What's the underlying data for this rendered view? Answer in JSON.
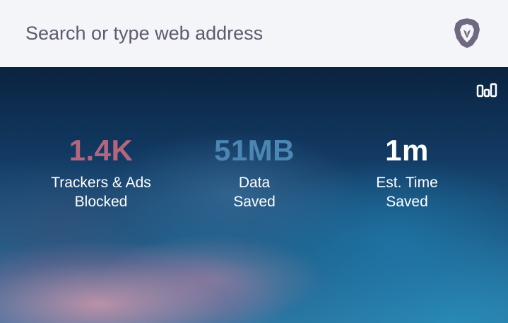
{
  "search": {
    "placeholder": "Search or type web address"
  },
  "icons": {
    "browser_logo": "brave-lion-icon",
    "stats": "stats-chart-icon"
  },
  "stats": [
    {
      "value": "1.4K",
      "label_line1": "Trackers & Ads",
      "label_line2": "Blocked",
      "color": "#b4667f"
    },
    {
      "value": "51MB",
      "label_line1": "Data",
      "label_line2": "Saved",
      "color": "#4c86b4"
    },
    {
      "value": "1m",
      "label_line1": "Est. Time",
      "label_line2": "Saved",
      "color": "#ffffff"
    }
  ],
  "colors": {
    "urlbar_bg": "#f3f5f9",
    "placeholder": "#5f5a6d",
    "logo": "#6e6880"
  }
}
